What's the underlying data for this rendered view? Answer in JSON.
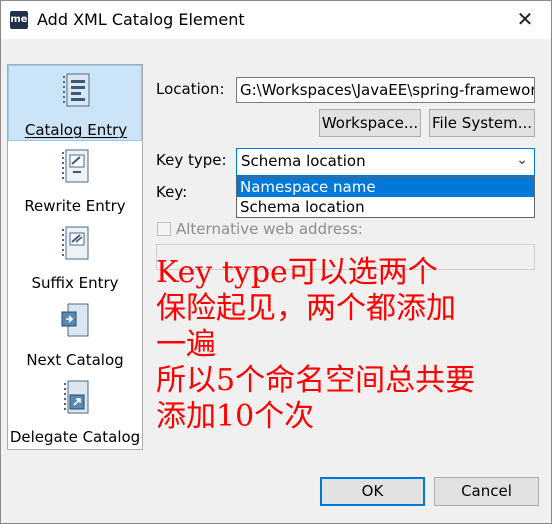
{
  "window": {
    "app_icon_text": "me",
    "title": "Add XML Catalog Element",
    "close_glyph": "✕"
  },
  "sidebar": {
    "items": [
      {
        "label": "Catalog Entry",
        "icon": "catalog-entry-icon",
        "selected": true
      },
      {
        "label": "Rewrite Entry",
        "icon": "rewrite-entry-icon",
        "selected": false
      },
      {
        "label": "Suffix Entry",
        "icon": "suffix-entry-icon",
        "selected": false
      },
      {
        "label": "Next Catalog",
        "icon": "next-catalog-icon",
        "selected": false
      },
      {
        "label": "Delegate Catalog",
        "icon": "delegate-catalog-icon",
        "selected": false
      }
    ]
  },
  "form": {
    "location_label": "Location:",
    "location_value": "G:\\Workspaces\\JavaEE\\spring-frameworl",
    "workspace_button": "Workspace...",
    "filesystem_button": "File System...",
    "key_type_label": "Key type:",
    "key_type_value": "Schema location",
    "key_type_options": [
      "Namespace name",
      "Schema location"
    ],
    "key_label": "Key:",
    "alt_web_label": "Alternative web address:"
  },
  "annotation": {
    "lines": [
      "Key type可以选两个",
      "保险起见，两个都添加",
      "一遍",
      "所以5个命名空间总共要",
      "添加10个次"
    ],
    "color": "#ff0000"
  },
  "footer": {
    "ok_label": "OK",
    "cancel_label": "Cancel"
  },
  "colors": {
    "selection": "#cce4f7",
    "accent": "#0078d7"
  }
}
